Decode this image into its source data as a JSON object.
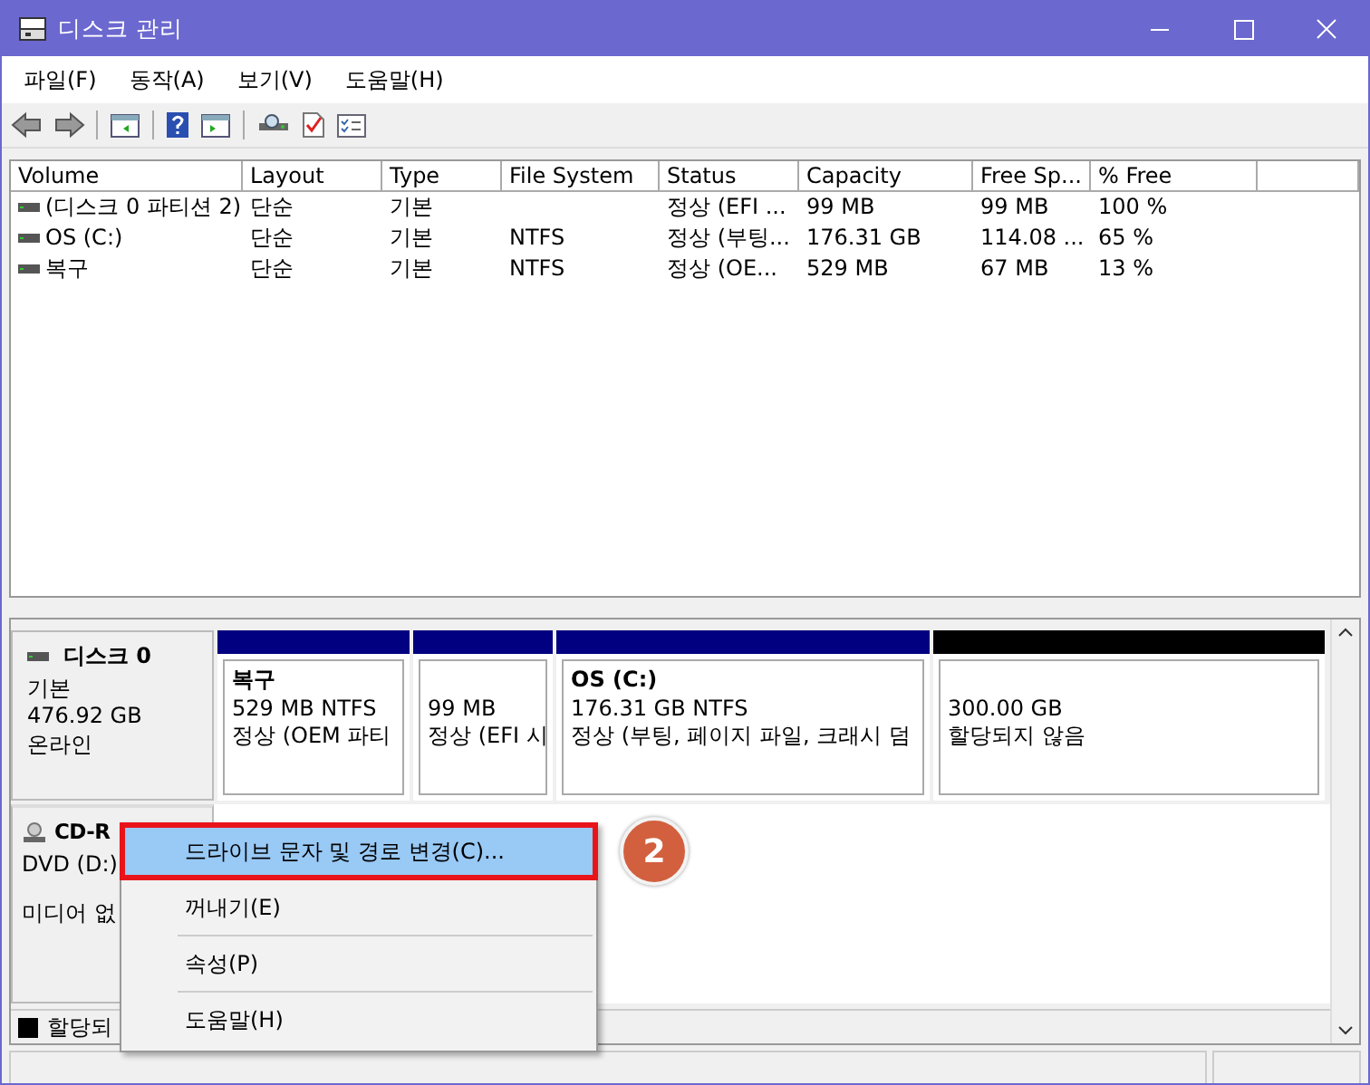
{
  "window": {
    "title": "디스크 관리"
  },
  "menu": [
    "파일(F)",
    "동작(A)",
    "보기(V)",
    "도움말(H)"
  ],
  "volumes": {
    "columns": [
      "Volume",
      "Layout",
      "Type",
      "File System",
      "Status",
      "Capacity",
      "Free Sp...",
      "% Free"
    ],
    "rows": [
      {
        "cells": [
          "(디스크 0 파티션 2)",
          "단순",
          "기본",
          "",
          "정상 (EFI ...",
          "99 MB",
          "99 MB",
          "100 %"
        ]
      },
      {
        "cells": [
          "OS (C:)",
          "단순",
          "기본",
          "NTFS",
          "정상 (부팅...",
          "176.31 GB",
          "114.08 ...",
          "65 %"
        ]
      },
      {
        "cells": [
          "복구",
          "단순",
          "기본",
          "NTFS",
          "정상 (OE...",
          "529 MB",
          "67 MB",
          "13 %"
        ]
      }
    ]
  },
  "disks": [
    {
      "name": "디스크 0",
      "type": "기본",
      "size": "476.92 GB",
      "status": "온라인",
      "partitions": [
        {
          "kind": "primary",
          "name": "복구",
          "size": "529 MB NTFS",
          "status": "정상 (OEM 파티"
        },
        {
          "kind": "primary",
          "size": "99 MB",
          "status": "정상 (EFI 시"
        },
        {
          "kind": "primary",
          "name": "OS  (C:)",
          "size": "176.31 GB NTFS",
          "status": "정상 (부팅, 페이지 파일, 크래시 덤"
        },
        {
          "kind": "unallocated",
          "size": "300.00 GB",
          "status": "할당되지 않음"
        }
      ]
    }
  ],
  "cdrom": {
    "name": "CD-R",
    "drive": "DVD (D:)",
    "status": "미디어 없"
  },
  "legend": [
    {
      "label": "할당되",
      "color": "#000000"
    }
  ],
  "context_menu": {
    "items": [
      {
        "label": "드라이브 문자 및 경로 변경(C)...",
        "selected": true
      },
      {
        "label": "꺼내기(E)",
        "selected": false
      },
      {
        "label": "속성(P)",
        "selected": false
      },
      {
        "label": "도움말(H)",
        "selected": false
      }
    ]
  },
  "annotation": {
    "label": "2"
  }
}
